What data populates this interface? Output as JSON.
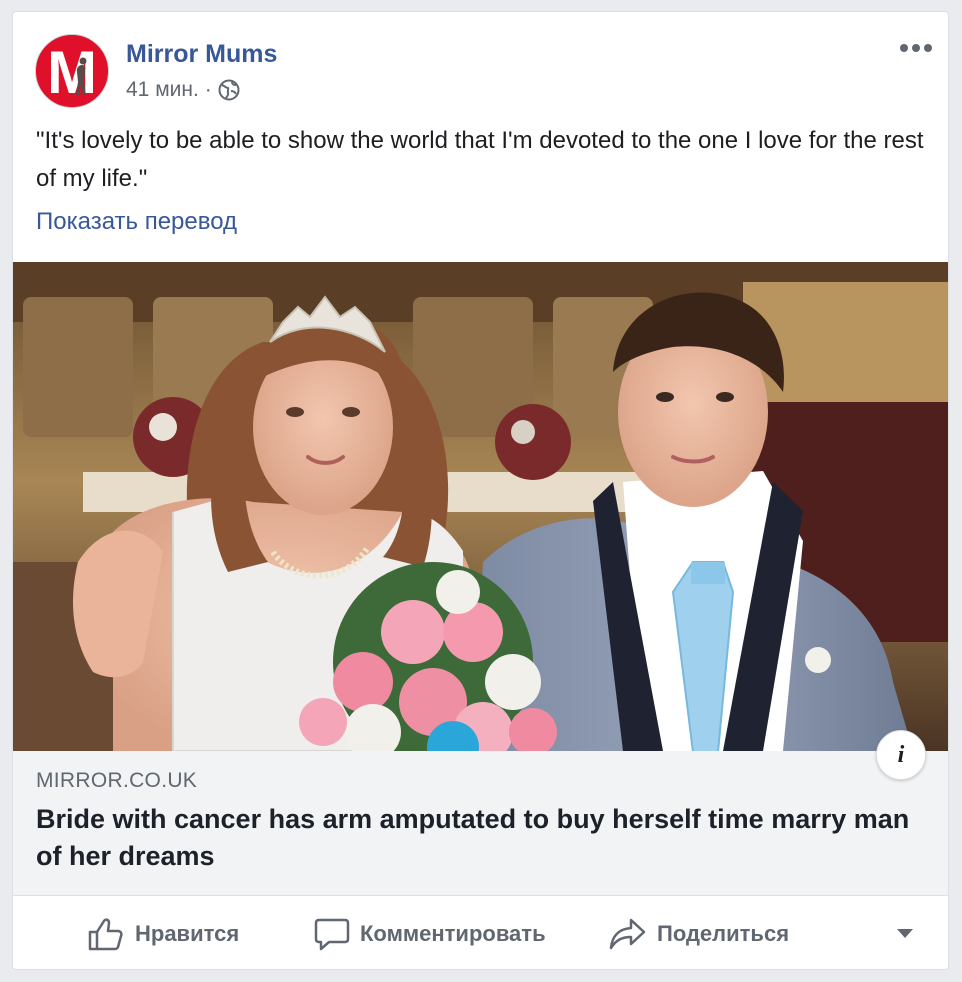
{
  "post": {
    "page_name": "Mirror Mums",
    "time": "41 мин.",
    "separator": "·",
    "privacy_icon": "globe-icon",
    "avatar_letter": "M",
    "text": "\"It's lovely to be able to show the world that I'm devoted to the one I love for the rest of my life.\"",
    "translate_label": "Показать перевод"
  },
  "link": {
    "domain": "MIRROR.CO.UK",
    "title": "Bride with cancer has arm amputated to buy herself time marry man of her dreams",
    "info_label": "i"
  },
  "actions": {
    "like": "Нравится",
    "comment": "Комментировать",
    "share": "Поделиться"
  },
  "colors": {
    "brand_blue": "#385898",
    "mirror_red": "#e1102a",
    "background": "#e9ebee",
    "link_box_bg": "#f2f3f5"
  }
}
